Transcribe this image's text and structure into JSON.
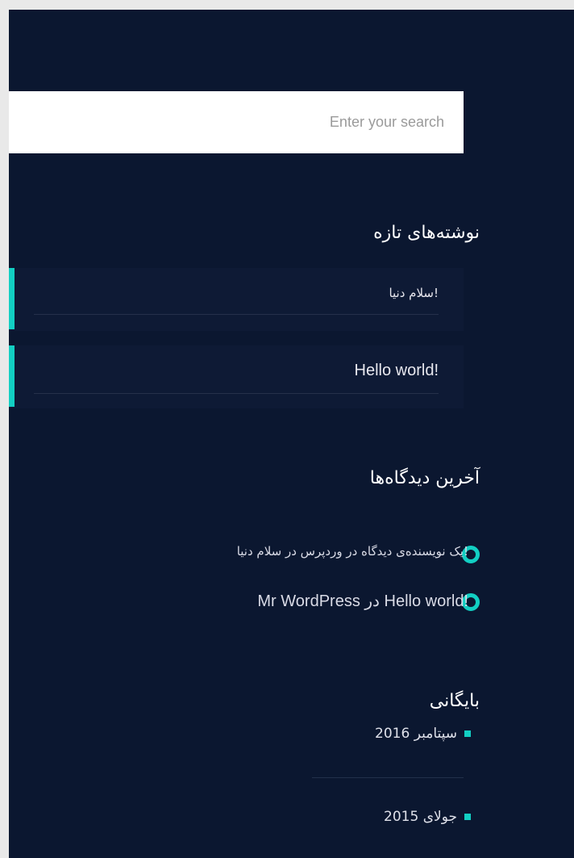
{
  "search": {
    "placeholder": "Enter your search"
  },
  "recent_posts": {
    "heading": "نوشته‌های تازه",
    "items": [
      {
        "title": "سلام دنیا!"
      },
      {
        "title": "Hello world!"
      }
    ]
  },
  "recent_comments": {
    "heading": "آخرین دیدگاه‌ها",
    "items": [
      {
        "text": "یک نویسنده‌ی دیدگاه در وردپرس در سلام دنیا!"
      },
      {
        "text": "Mr WordPress در Hello world!"
      }
    ]
  },
  "archives": {
    "heading": "بایگانی",
    "items": [
      {
        "label": "سپتامبر 2016"
      },
      {
        "label": "جولای 2015"
      }
    ]
  },
  "colors": {
    "background": "#0b1730",
    "accent": "#12cfc3",
    "page_margin": "#e9e9e9"
  }
}
